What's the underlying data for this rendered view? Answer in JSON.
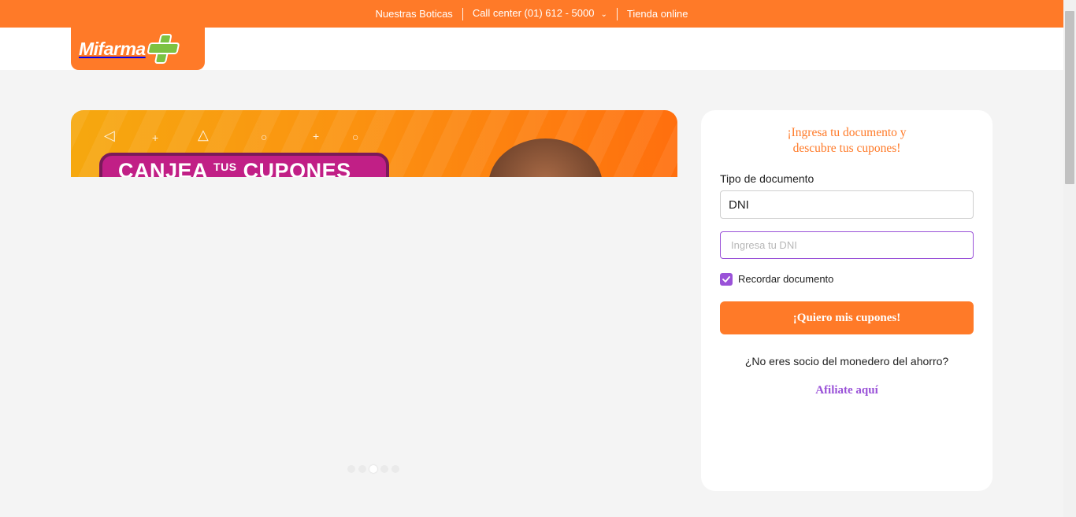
{
  "topbar": {
    "links": [
      "Nuestras Boticas",
      "Call center (01) 612 - 5000",
      "Tienda online"
    ]
  },
  "brand": {
    "name": "Mifarma",
    "color": "#ff7a28",
    "cross_color": "#7cc242"
  },
  "banner": {
    "title": "CANJEA",
    "title_small": "TUS",
    "title_end": "CUPONES",
    "carousel_active_index": 2,
    "carousel_count": 5
  },
  "form": {
    "heading_line1": "¡Ingresa tu documento y",
    "heading_line2": "descubre tus cupones!",
    "doc_type_label": "Tipo de documento",
    "doc_type_value": "DNI",
    "doc_number_placeholder": "Ingresa tu DNI",
    "remember_label": "Recordar documento",
    "remember_checked": true,
    "submit_label": "¡Quiero mis cupones!",
    "question": "¿No eres socio del monedero del ahorro?",
    "affiliate_link": "Afiliate aquí"
  },
  "colors": {
    "accent": "#ff7a28",
    "purple": "#9a52d8"
  }
}
